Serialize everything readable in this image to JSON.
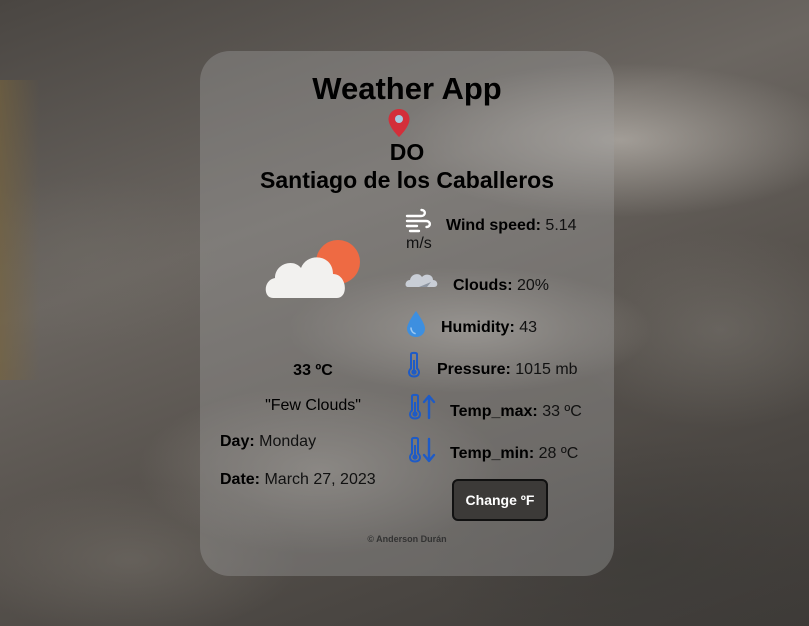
{
  "app": {
    "title": "Weather App"
  },
  "location": {
    "country": "DO",
    "city": "Santiago de los Caballeros",
    "icon": "map-pin-icon",
    "icon_color": "#d32f3a"
  },
  "current": {
    "icon": "few-clouds-icon",
    "temperature": "33 ºC",
    "description": "\"Few Clouds\"",
    "day_label": "Day:",
    "day_value": "Monday",
    "date_label": "Date:",
    "date_value": "March 27, 2023"
  },
  "stats": {
    "wind": {
      "label": "Wind speed:",
      "value": "5.14",
      "unit": "m/s",
      "icon": "wind-icon"
    },
    "clouds": {
      "label": "Clouds:",
      "value": "20%",
      "icon": "cloud-icon"
    },
    "humidity": {
      "label": "Humidity:",
      "value": "43",
      "icon": "water-drop-icon"
    },
    "pressure": {
      "label": "Pressure:",
      "value": "1015 mb",
      "icon": "thermometer-icon"
    },
    "temp_max": {
      "label": "Temp_max:",
      "value": "33 ºC",
      "icon": "thermometer-up-icon"
    },
    "temp_min": {
      "label": "Temp_min:",
      "value": "28 ºC",
      "icon": "thermometer-down-icon"
    }
  },
  "controls": {
    "change_label": "Change ºF"
  },
  "footer": {
    "text": "© Anderson Durán"
  },
  "colors": {
    "sun": "#ee6a43",
    "thermo_blue": "#1e5bc6",
    "drop_blue": "#3d8fe0"
  }
}
